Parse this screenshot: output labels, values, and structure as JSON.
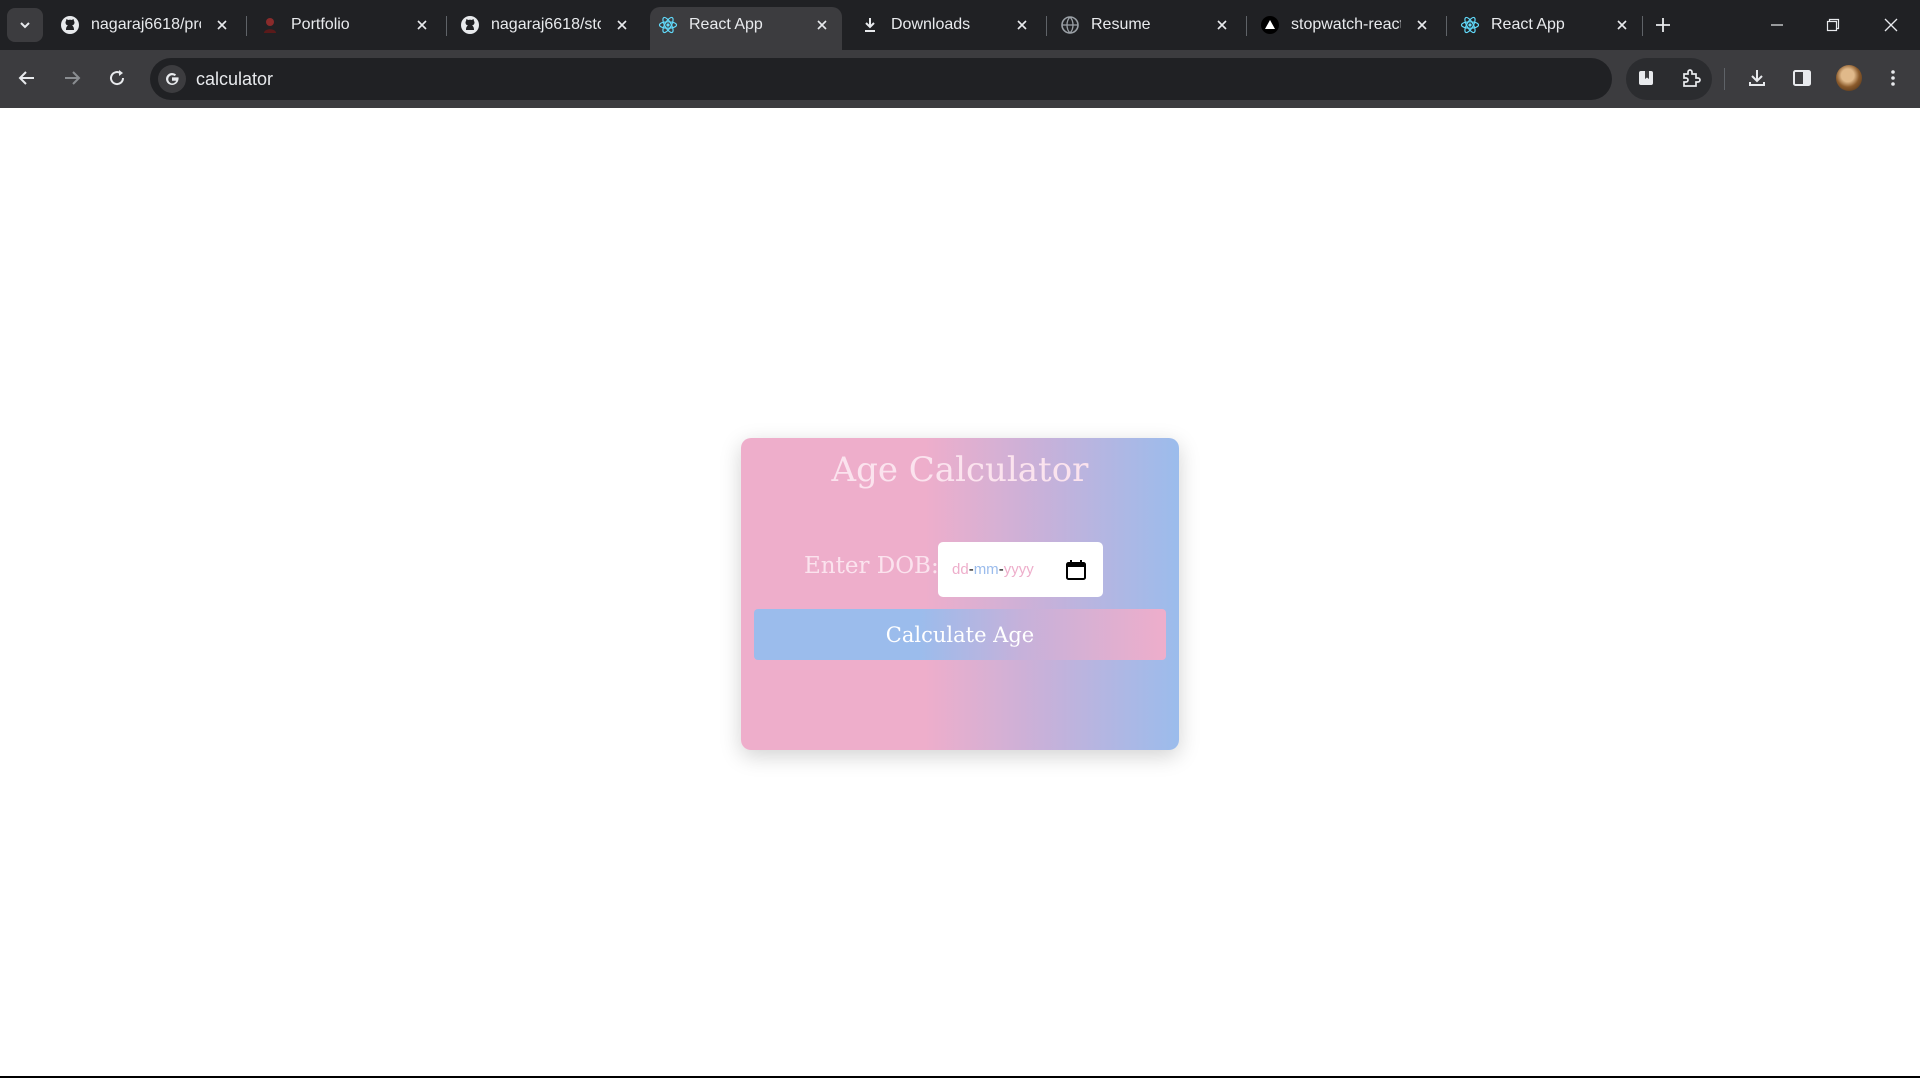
{
  "browser": {
    "tabs": [
      {
        "title": "nagaraj6618/pro",
        "favicon": "github-icon",
        "active": false
      },
      {
        "title": "Portfolio",
        "favicon": "portfolio-icon",
        "active": false
      },
      {
        "title": "nagaraj6618/sto",
        "favicon": "github-icon",
        "active": false
      },
      {
        "title": "React App",
        "favicon": "react-icon",
        "active": true
      },
      {
        "title": "Downloads",
        "favicon": "download-icon",
        "active": false
      },
      {
        "title": "Resume",
        "favicon": "globe-icon",
        "active": false
      },
      {
        "title": "stopwatch-react",
        "favicon": "vercel-icon",
        "active": false
      },
      {
        "title": "React App",
        "favicon": "react-icon",
        "active": false
      }
    ],
    "omnibox": {
      "text": "calculator"
    }
  },
  "page": {
    "title": "Age Calculator",
    "dob_label": "Enter DOB:",
    "date_placeholder": {
      "dd": "dd",
      "mm": "mm",
      "yyyy": "yyyy",
      "sep": "-"
    },
    "button_label": "Calculate Age"
  },
  "colors": {
    "pink": "#eeaecb",
    "blue": "#9bbcec",
    "lavender": "#c6b1da",
    "title_text": "#fbe3ee"
  }
}
